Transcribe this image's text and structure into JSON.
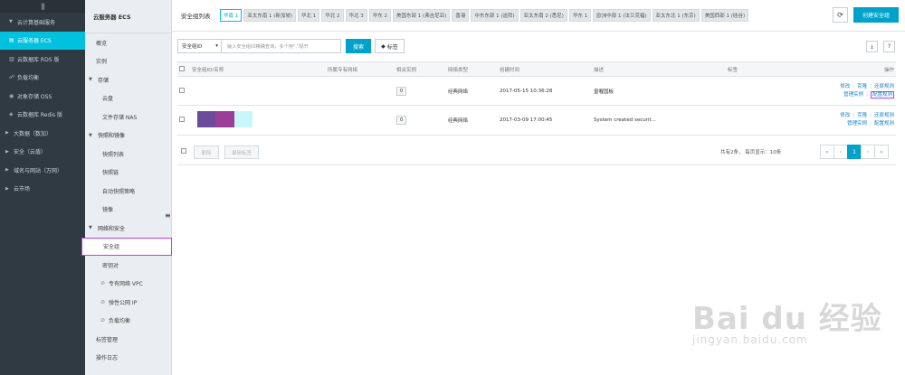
{
  "nav": {
    "items": [
      {
        "label": "云计算基础服务",
        "icon": "caret-down-icon"
      },
      {
        "label": "云服务器 ECS",
        "icon": "server-icon"
      },
      {
        "label": "云数据库 RDS 版",
        "icon": "database-icon"
      },
      {
        "label": "负载均衡",
        "icon": "load-balance-icon"
      },
      {
        "label": "对象存储 OSS",
        "icon": "storage-icon"
      },
      {
        "label": "云数据库 Redis 版",
        "icon": "redis-icon"
      },
      {
        "label": "大数据（数加）",
        "icon": "caret-right-icon"
      },
      {
        "label": "安全（云盾）",
        "icon": "caret-right-icon"
      },
      {
        "label": "域名与网站（万网）",
        "icon": "caret-right-icon"
      },
      {
        "label": "云市场",
        "icon": "caret-right-icon"
      }
    ]
  },
  "sidebar": {
    "title": "云服务器 ECS",
    "overview": "概览",
    "instances": "实例",
    "storage_group": "存储",
    "cloud_disk": "云盘",
    "nas": "文件存储 NAS",
    "snapshot_group": "快照和镜像",
    "snapshot_list": "快照列表",
    "snapshot_chain": "快照链",
    "auto_snapshot": "自动快照策略",
    "image": "镜像",
    "netsec_group": "网络和安全",
    "security_group": "安全组",
    "keypair": "密钥对",
    "vpc": "专有网络 VPC",
    "eip": "弹性公网 IP",
    "slb": "负载均衡",
    "tags": "标签管理",
    "logs": "操作日志"
  },
  "header": {
    "title": "安全组列表",
    "regions": [
      "华南 1",
      "亚太东南 1 (新加坡)",
      "华北 1",
      "华北 2",
      "华北 3",
      "华东 2",
      "美国东部 1 (弗吉尼亚)",
      "香港",
      "中东东部 1 (迪拜)",
      "亚太东南 2 (悉尼)",
      "华东 1",
      "欧洲中部 1 (法兰克福)",
      "亚太东北 1 (东京)",
      "美国西部 1 (硅谷)"
    ],
    "refresh_icon": "refresh-icon",
    "create_label": "创建安全组"
  },
  "filter": {
    "select_value": "安全组ID",
    "placeholder": "输入安全组ID精确查询，多个用\",\"隔开",
    "search_label": "搜索",
    "tag_label": "标签"
  },
  "table": {
    "columns": [
      "安全组ID/名称",
      "所属专有网络",
      "相关实例",
      "网络类型",
      "创建时间",
      "描述",
      "标签",
      "操作"
    ],
    "rows": [
      {
        "count": "0",
        "net_type": "经典网络",
        "created": "2017-05-15 10:36:28",
        "desc": "皇喔国板",
        "ops": [
          "修改",
          "克隆",
          "还原规则",
          "管理实例",
          "配置规则"
        ]
      },
      {
        "count": "0",
        "net_type": "经典网络",
        "created": "2017-03-09 17:00:45",
        "desc": "System created securit...",
        "ops": [
          "修改",
          "克隆",
          "还原规则",
          "管理实例",
          "配置规则"
        ]
      }
    ]
  },
  "footer": {
    "delete_label": "删除",
    "edit_tag_label": "编辑标签",
    "page_info": "共有2条， 每页显示：10条",
    "pages": [
      "«",
      "‹",
      "1",
      "›",
      "»"
    ]
  },
  "watermark": {
    "brand": "Bai du 经验",
    "url": "jingyan.baidu.com"
  },
  "colors": {
    "accent": "#00a2ca",
    "active_nav": "#00c1de",
    "highlight": "#c13ddb",
    "nav_bg": "#2f3a42"
  }
}
